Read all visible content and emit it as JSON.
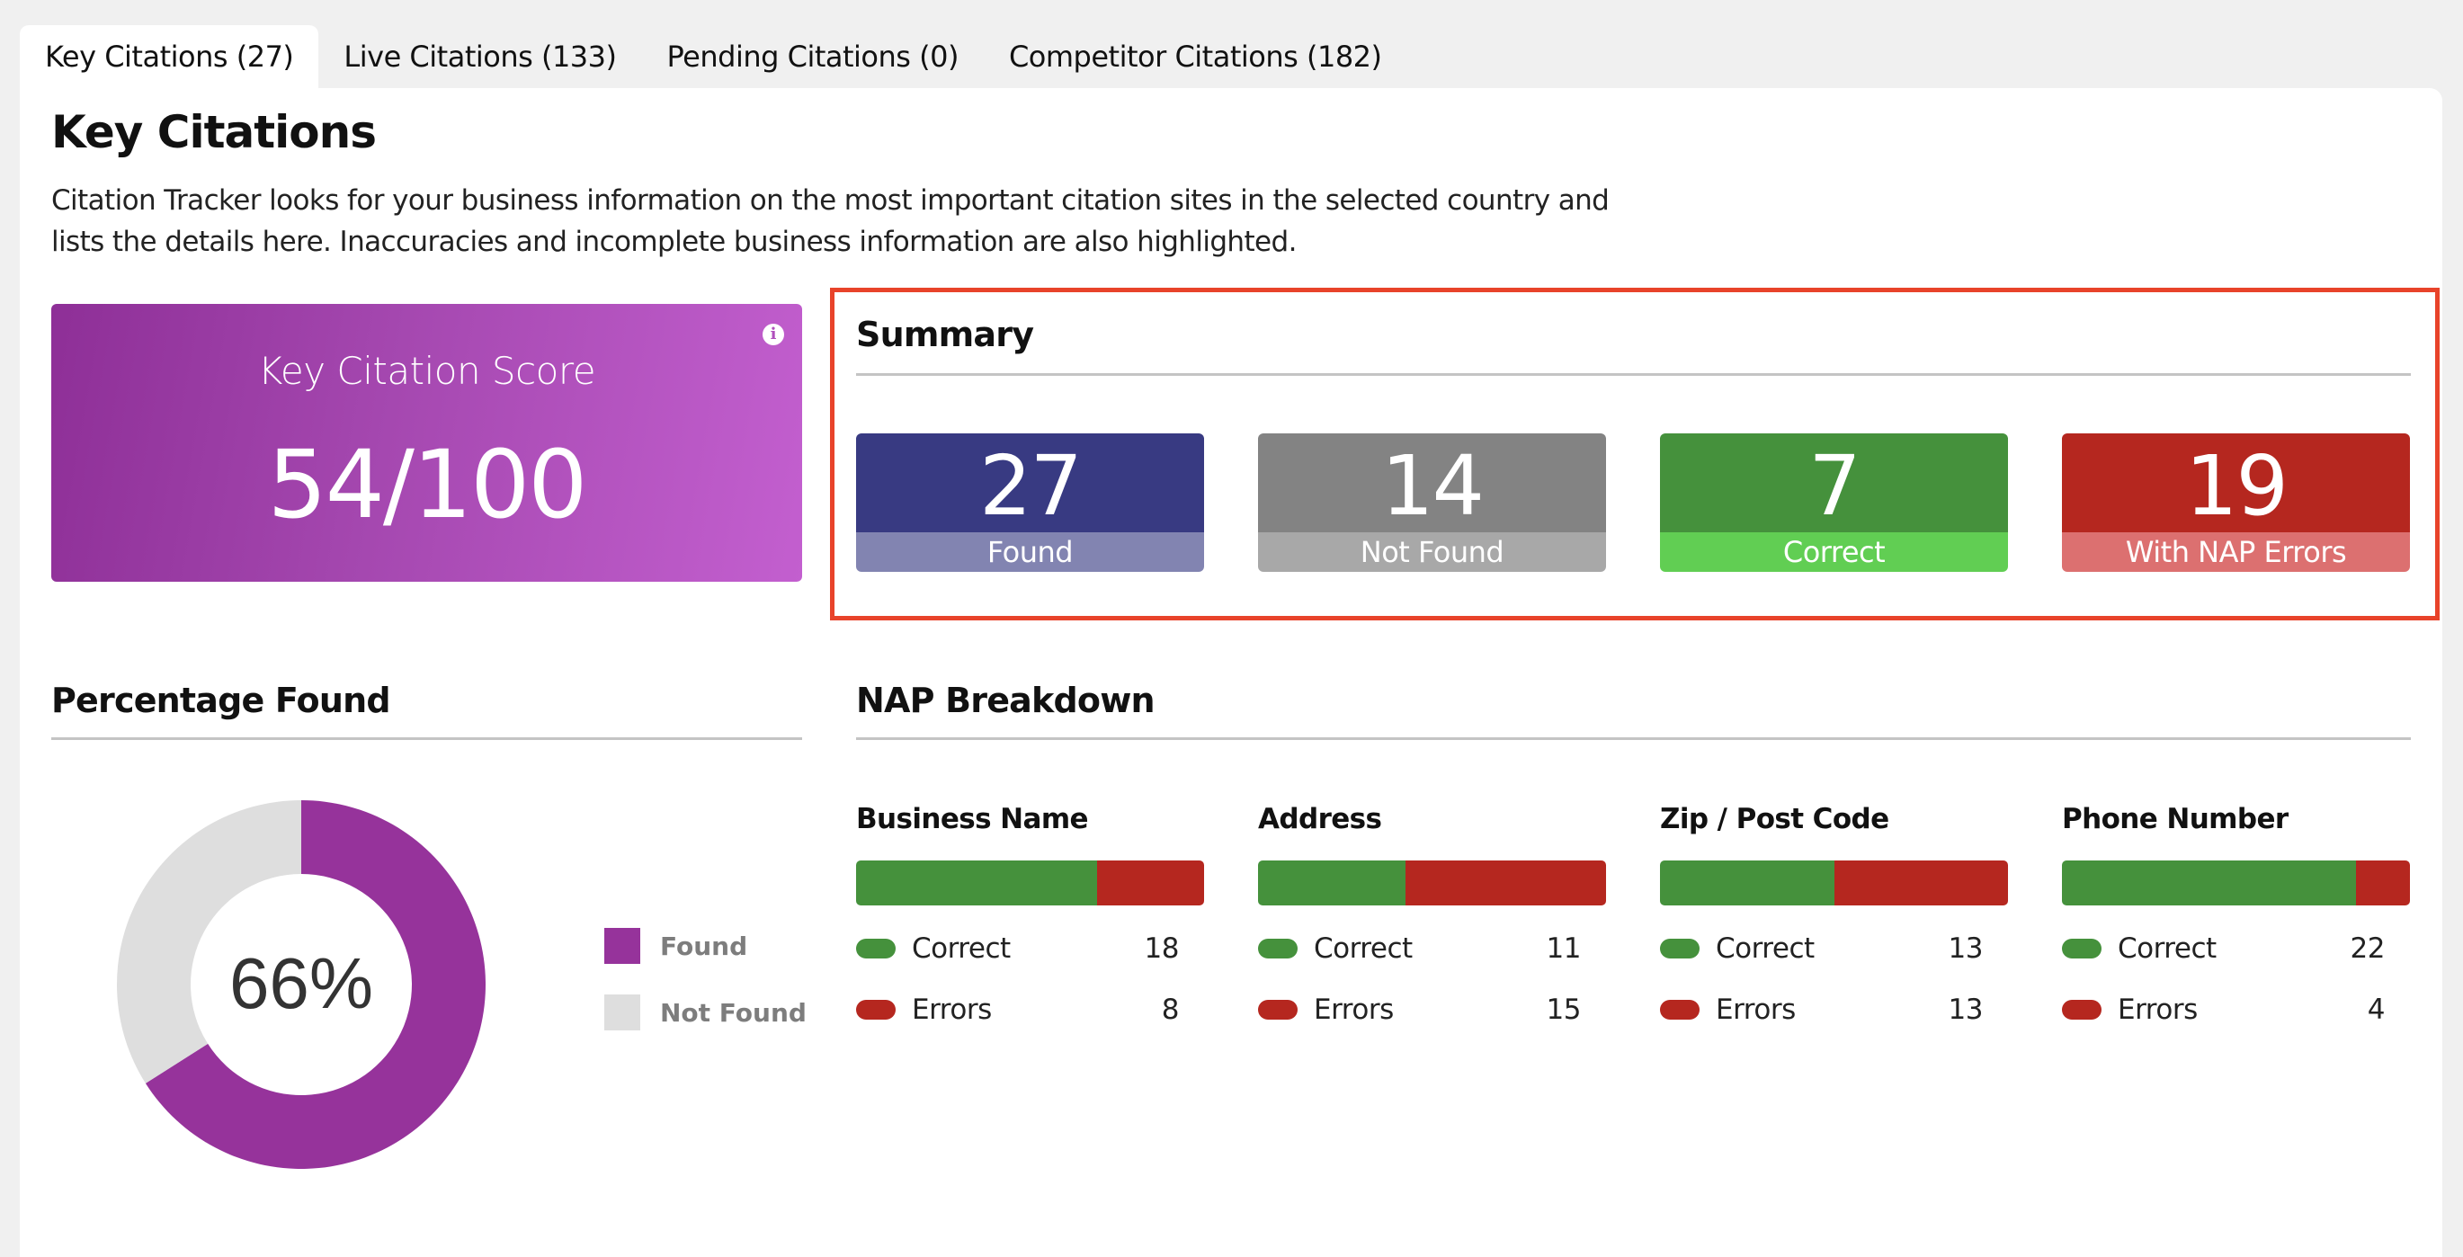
{
  "tabs": [
    {
      "label": "Key Citations (27)",
      "active": true
    },
    {
      "label": "Live Citations (133)",
      "active": false
    },
    {
      "label": "Pending Citations (0)",
      "active": false
    },
    {
      "label": "Competitor Citations (182)",
      "active": false
    }
  ],
  "page": {
    "title": "Key Citations",
    "description": "Citation Tracker looks for your business information on the most important citation sites in the selected country and lists the details here. Inaccuracies and incomplete business information are also highlighted."
  },
  "score_card": {
    "label": "Key Citation Score",
    "value": "54/100",
    "info_icon": "info-icon",
    "info_glyph": "i"
  },
  "summary": {
    "title": "Summary",
    "highlight_color": "#e8432a",
    "tiles": [
      {
        "value": "27",
        "label": "Found",
        "color": "#383a82",
        "band_color": "#8284b1"
      },
      {
        "value": "14",
        "label": "Not Found",
        "color": "#838383",
        "band_color": "#a8a8a8"
      },
      {
        "value": "7",
        "label": "Correct",
        "color": "#45913c",
        "band_color": "#61ce53"
      },
      {
        "value": "19",
        "label": "With NAP Errors",
        "color": "#b5271f",
        "band_color": "#dc7070"
      }
    ]
  },
  "percentage_found": {
    "title": "Percentage Found",
    "center_label": "66%"
  },
  "nap_breakdown": {
    "title": "NAP Breakdown",
    "correct_color": "#45913c",
    "error_color": "#b5271f",
    "columns": [
      {
        "heading": "Business Name",
        "correct_label": "Correct",
        "correct": 18,
        "errors_label": "Errors",
        "errors": 8
      },
      {
        "heading": "Address",
        "correct_label": "Correct",
        "correct": 11,
        "errors_label": "Errors",
        "errors": 15
      },
      {
        "heading": "Zip / Post Code",
        "correct_label": "Correct",
        "correct": 13,
        "errors_label": "Errors",
        "errors": 13
      },
      {
        "heading": "Phone Number",
        "correct_label": "Correct",
        "correct": 22,
        "errors_label": "Errors",
        "errors": 4
      }
    ]
  },
  "chart_data": {
    "type": "pie",
    "title": "Percentage Found",
    "center_label": "66%",
    "categories": [
      "Found",
      "Not Found"
    ],
    "values": [
      66,
      34
    ],
    "colors": [
      "#96339b",
      "#dedede"
    ],
    "legend": [
      {
        "label": "Found",
        "color": "#96339b"
      },
      {
        "label": "Not Found",
        "color": "#dedede"
      }
    ],
    "legend_position": "right",
    "donut": true
  }
}
